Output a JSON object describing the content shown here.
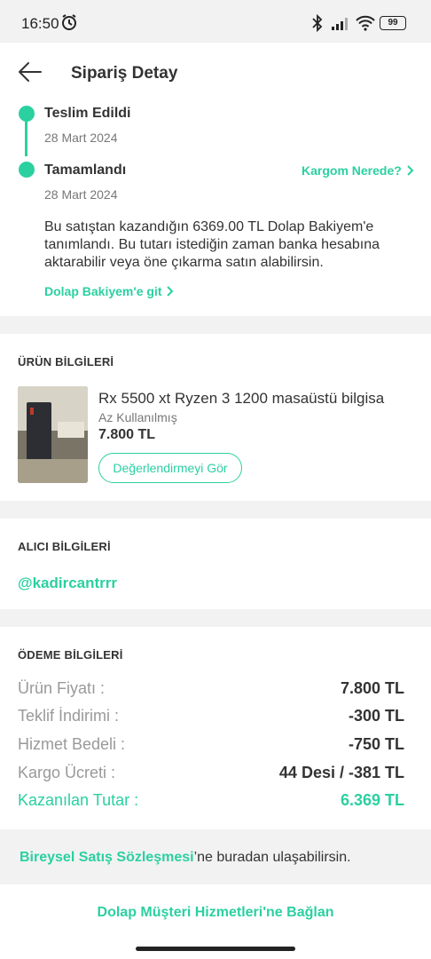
{
  "status_bar": {
    "time": "16:50",
    "battery": "99"
  },
  "header": {
    "title": "Sipariş Detay"
  },
  "timeline": {
    "delivered_label": "Teslim Edildi",
    "delivered_date": "28 Mart 2024",
    "completed_label": "Tamamlandı",
    "completed_date": "28 Mart 2024",
    "cargo_link": "Kargom Nerede?",
    "message": "Bu satıştan kazandığın 6369.00 TL Dolap Bakiyem'e tanımlandı. Bu tutarı istediğin zaman banka hesabına aktarabilir veya öne çıkarma satın alabilirsin.",
    "balance_link": "Dolap Bakiyem'e git"
  },
  "product": {
    "section_title": "ÜRÜN BİLGİLERİ",
    "name": "Rx 5500 xt Ryzen 3 1200 masaüstü bilgisa",
    "condition": "Az Kullanılmış",
    "price": "7.800 TL",
    "review_button": "Değerlendirmeyi Gör"
  },
  "buyer": {
    "section_title": "ALICI BİLGİLERİ",
    "username": "@kadircantrrr"
  },
  "payment": {
    "section_title": "ÖDEME BİLGİLERİ",
    "rows": [
      {
        "label": "Ürün Fiyatı :",
        "value": "7.800 TL"
      },
      {
        "label": "Teklif İndirimi :",
        "value": "-300 TL"
      },
      {
        "label": "Hizmet Bedeli :",
        "value": "-750 TL"
      },
      {
        "label": "Kargo Ücreti :",
        "value": "44 Desi / -381 TL"
      },
      {
        "label": "Kazanılan Tutar :",
        "value": "6.369 TL"
      }
    ]
  },
  "contract": {
    "link": "Bireysel Satış Sözleşmesi",
    "rest": "’ne buradan ulaşabilirsin."
  },
  "support": {
    "link": "Dolap Müşteri Hizmetleri'ne Bağlan"
  },
  "colors": {
    "accent": "#2bd0a0",
    "background": "#f2f2f2"
  }
}
